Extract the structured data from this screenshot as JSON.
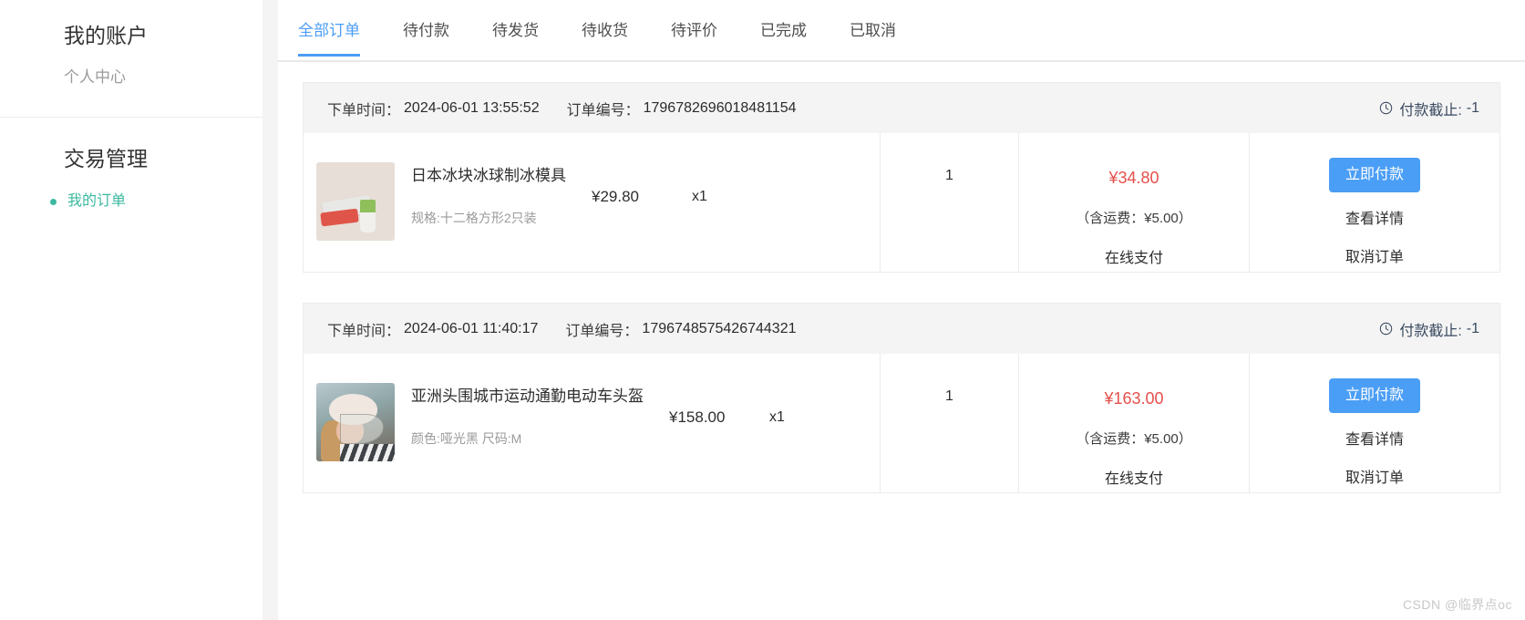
{
  "sidebar": {
    "account_title": "我的账户",
    "account_sub": "个人中心",
    "trade_title": "交易管理",
    "orders_link": "我的订单",
    "accent_color": "#3bb8a0"
  },
  "tabs": [
    {
      "label": "全部订单",
      "active": true
    },
    {
      "label": "待付款",
      "active": false
    },
    {
      "label": "待发货",
      "active": false
    },
    {
      "label": "待收货",
      "active": false
    },
    {
      "label": "待评价",
      "active": false
    },
    {
      "label": "已完成",
      "active": false
    },
    {
      "label": "已取消",
      "active": false
    }
  ],
  "labels": {
    "order_time": "下单时间：",
    "order_no": "订单编号：",
    "deadline_prefix": "付款截止:",
    "pay_button": "立即付款",
    "detail_link": "查看详情",
    "cancel_link": "取消订单"
  },
  "colors": {
    "tab_active": "#4b9ef5",
    "price_red": "#e4504c",
    "button_blue": "#4b9ef5",
    "header_bg": "#f4f4f5"
  },
  "orders": [
    {
      "order_time": "2024-06-01 13:55:52",
      "order_no": "1796782696018481154",
      "deadline": "-1",
      "product_name": "日本冰块冰球制冰模具",
      "product_spec": "规格:十二格方形2只装",
      "unit_price": "¥29.80",
      "multiplier": "x1",
      "count": "1",
      "total": "¥34.80",
      "shipping": "（含运费：¥5.00）",
      "pay_method": "在线支付"
    },
    {
      "order_time": "2024-06-01 11:40:17",
      "order_no": "1796748575426744321",
      "deadline": "-1",
      "product_name": "亚洲头围城市运动通勤电动车头盔",
      "product_spec": "颜色:哑光黑 尺码:M",
      "unit_price": "¥158.00",
      "multiplier": "x1",
      "count": "1",
      "total": "¥163.00",
      "shipping": "（含运费：¥5.00）",
      "pay_method": "在线支付"
    }
  ],
  "watermark": "CSDN @临界点oc"
}
